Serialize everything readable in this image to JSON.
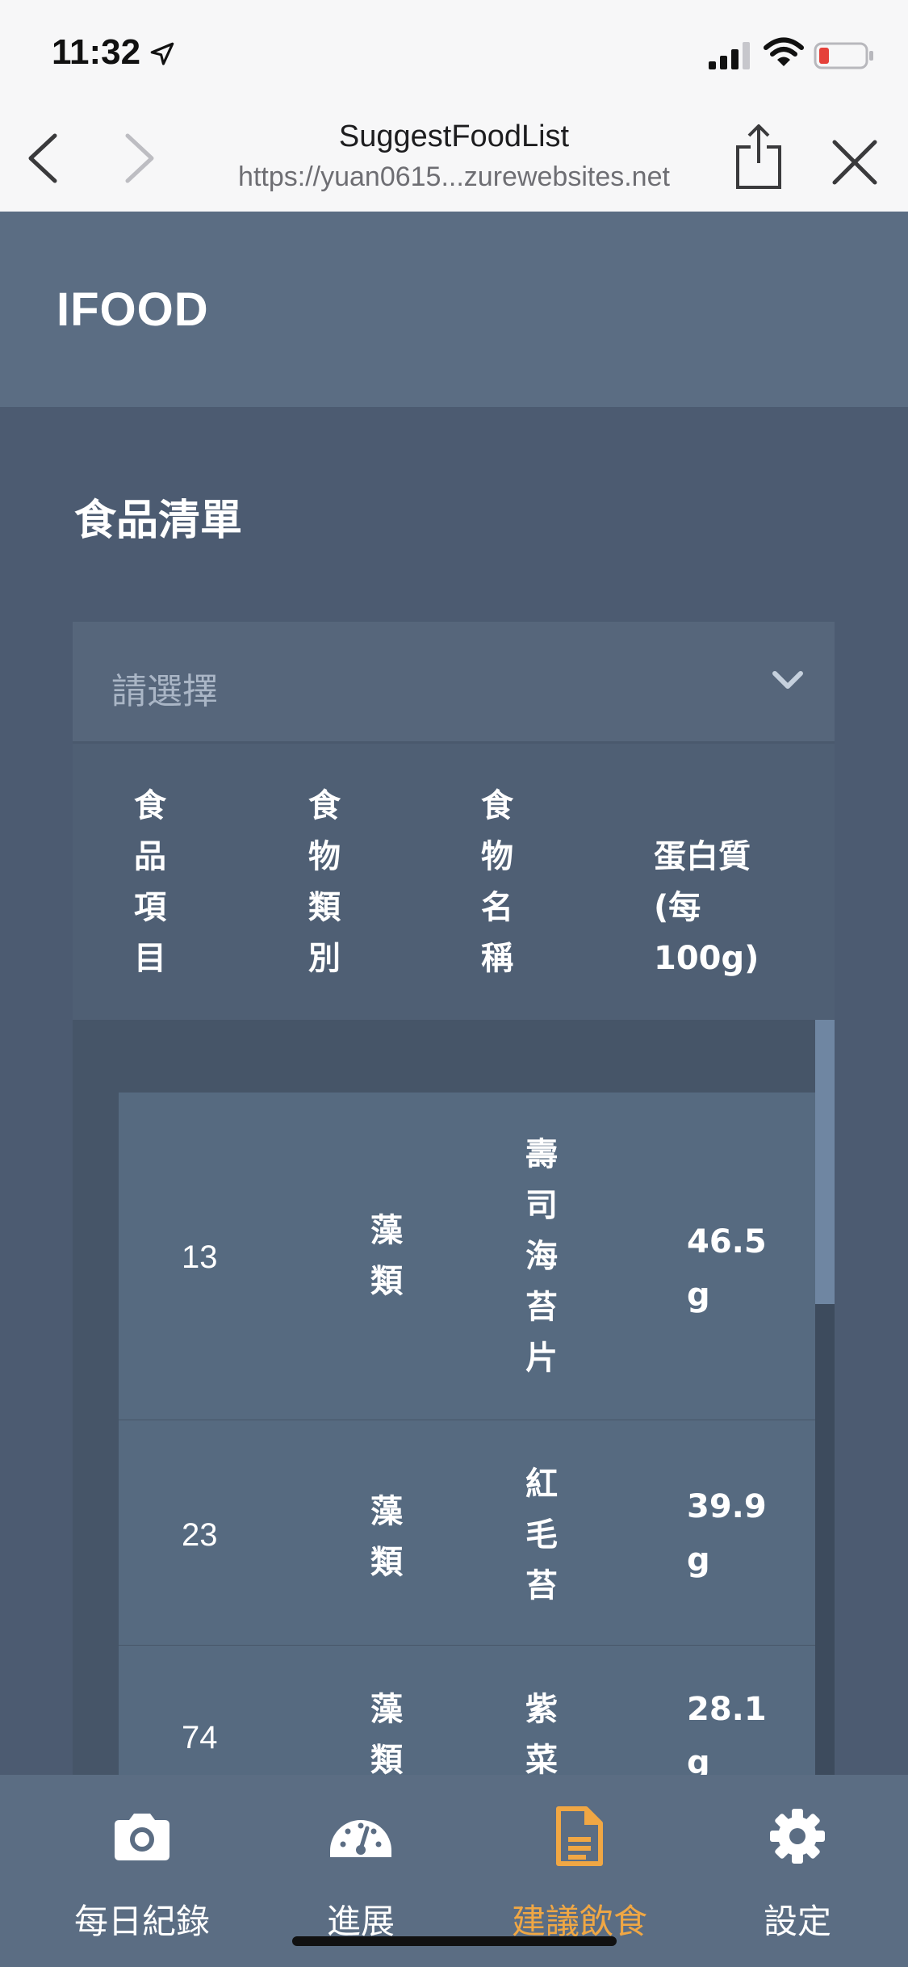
{
  "status_bar": {
    "time": "11:32"
  },
  "browser": {
    "page_title": "SuggestFoodList",
    "url": "https://yuan0615...zurewebsites.net"
  },
  "app": {
    "brand": "IFOOD"
  },
  "section": {
    "title": "食品清單"
  },
  "filter": {
    "placeholder": "請選擇"
  },
  "table": {
    "headers": [
      "食\n品\n項\n目",
      "食\n物\n類\n別",
      "食\n物\n名\n稱",
      "蛋白質\n(每\n100g)"
    ],
    "rows": [
      {
        "id": "13",
        "category": "藻\n類",
        "name": "壽\n司\n海\n苔\n片",
        "protein": "46.5\ng"
      },
      {
        "id": "23",
        "category": "藻\n類",
        "name": "紅\n毛\n苔",
        "protein": "39.9\ng"
      },
      {
        "id": "74",
        "category": "藻\n類",
        "name": "紫\n菜",
        "protein": "28.1\ng"
      }
    ]
  },
  "bottom_nav": {
    "items": [
      {
        "label": "每日紀錄",
        "icon": "camera-icon",
        "active": false
      },
      {
        "label": "進展",
        "icon": "gauge-icon",
        "active": false
      },
      {
        "label": "建議飲食",
        "icon": "document-icon",
        "active": true
      },
      {
        "label": "設定",
        "icon": "gear-icon",
        "active": false
      }
    ],
    "active_color": "#f0a744"
  }
}
